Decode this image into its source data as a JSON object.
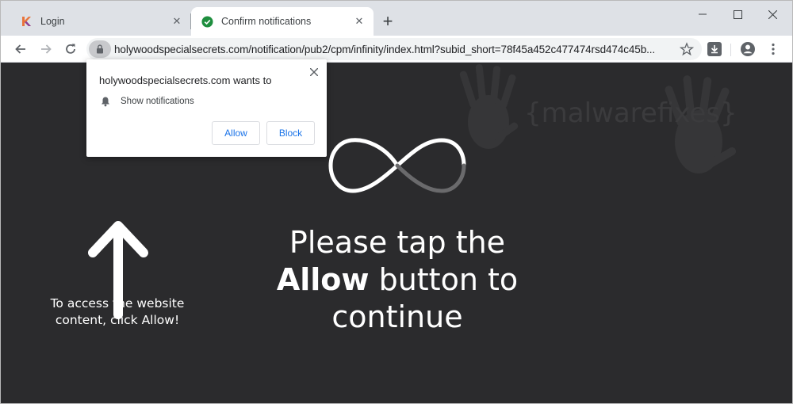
{
  "tabs": [
    {
      "title": "Login",
      "icon": "k-logo-icon"
    },
    {
      "title": "Confirm notifications",
      "icon": "check-circle-icon",
      "active": true
    }
  ],
  "toolbar": {
    "url": "holywoodspecialsecrets.com/notification/pub2/cpm/infinity/index.html?subid_short=78f45a452c477474rsd474c45b..."
  },
  "popup": {
    "title": "holywoodspecialsecrets.com wants to",
    "permission": "Show notifications",
    "allow_label": "Allow",
    "block_label": "Block"
  },
  "page": {
    "headline_line1": "Please tap the",
    "headline_bold": "Allow",
    "headline_line2_rest": " button to",
    "headline_line3": "continue",
    "hint": "To access the website content, click Allow!",
    "watermark": "{malwarefixes}"
  },
  "colors": {
    "page_bg": "#2b2b2d",
    "accent_blue": "#1a73e8",
    "tab_check_green": "#1e8e3e",
    "tab_k_orange": "#e8743b"
  }
}
